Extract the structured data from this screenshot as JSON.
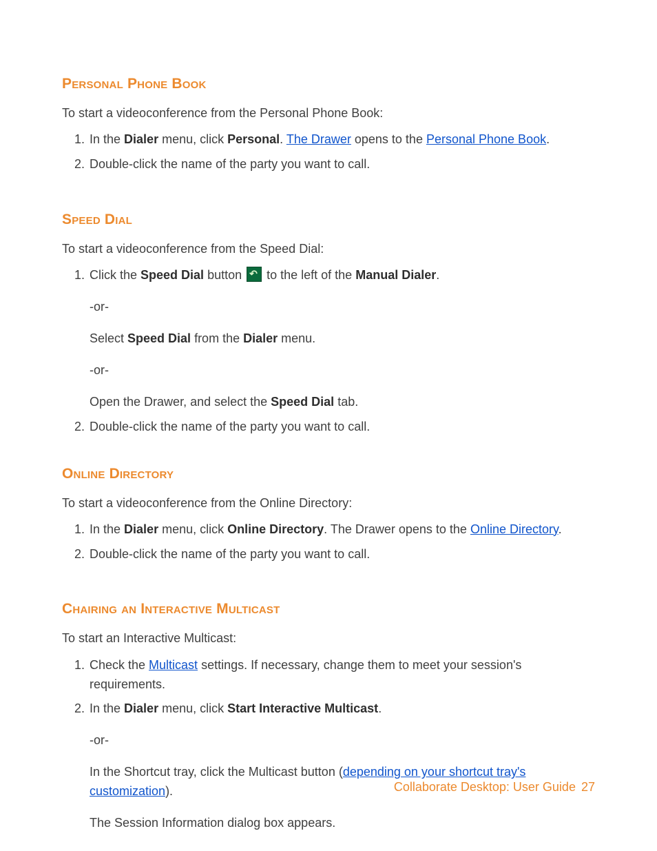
{
  "sections": {
    "ppb": {
      "heading": "Personal Phone Book",
      "intro": "To start a videoconference from the Personal Phone Book:",
      "step1_parts": {
        "t1": "In the ",
        "b1": "Dialer",
        "t2": " menu, click ",
        "b2": "Personal",
        "t3": ". ",
        "link1": "The Drawer",
        "t4": " opens to the ",
        "link2": "Personal Phone Book",
        "t5": "."
      },
      "step2": "Double-click the name of the party you want to call."
    },
    "sd": {
      "heading": "Speed Dial",
      "intro": "To start a videoconference from the Speed Dial:",
      "step1_parts": {
        "t1": "Click the ",
        "b1": "Speed Dial",
        "t2": " button ",
        "t3": " to the left of the ",
        "b2": "Manual Dialer",
        "t4": "."
      },
      "or": "-or-",
      "alt1_parts": {
        "t1": "Select ",
        "b1": "Speed Dial",
        "t2": " from the ",
        "b2": "Dialer",
        "t3": " menu."
      },
      "alt2_parts": {
        "t1": "Open the Drawer, and select the ",
        "b1": "Speed Dial",
        "t2": " tab."
      },
      "step2": "Double-click the name of the party you want to call."
    },
    "od": {
      "heading": "Online Directory",
      "intro": "To start a videoconference from the Online Directory:",
      "step1_parts": {
        "t1": "In the ",
        "b1": "Dialer",
        "t2": " menu, click ",
        "b2": "Online Directory",
        "t3": ". The Drawer opens to the ",
        "link1": "Online Directory",
        "t4": "."
      },
      "step2": "Double-click the name of the party you want to call."
    },
    "cm": {
      "heading": "Chairing an Interactive Multicast",
      "intro": "To start an Interactive Multicast:",
      "step1_parts": {
        "t1": "Check the ",
        "link1": "Multicast",
        "t2": " settings. If necessary, change them to meet your session's requirements."
      },
      "step2_parts": {
        "t1": "In the ",
        "b1": "Dialer",
        "t2": " menu, click ",
        "b2": "Start Interactive Multicast",
        "t3": "."
      },
      "or": "-or-",
      "alt1_parts": {
        "t1": "In the Shortcut tray, click the Multicast button (",
        "link1": "depending on your shortcut tray's customization",
        "t2": ")."
      },
      "after": "The Session Information dialog box appears."
    }
  },
  "footer": {
    "title": "Collaborate Desktop: User Guide",
    "page": "27"
  }
}
